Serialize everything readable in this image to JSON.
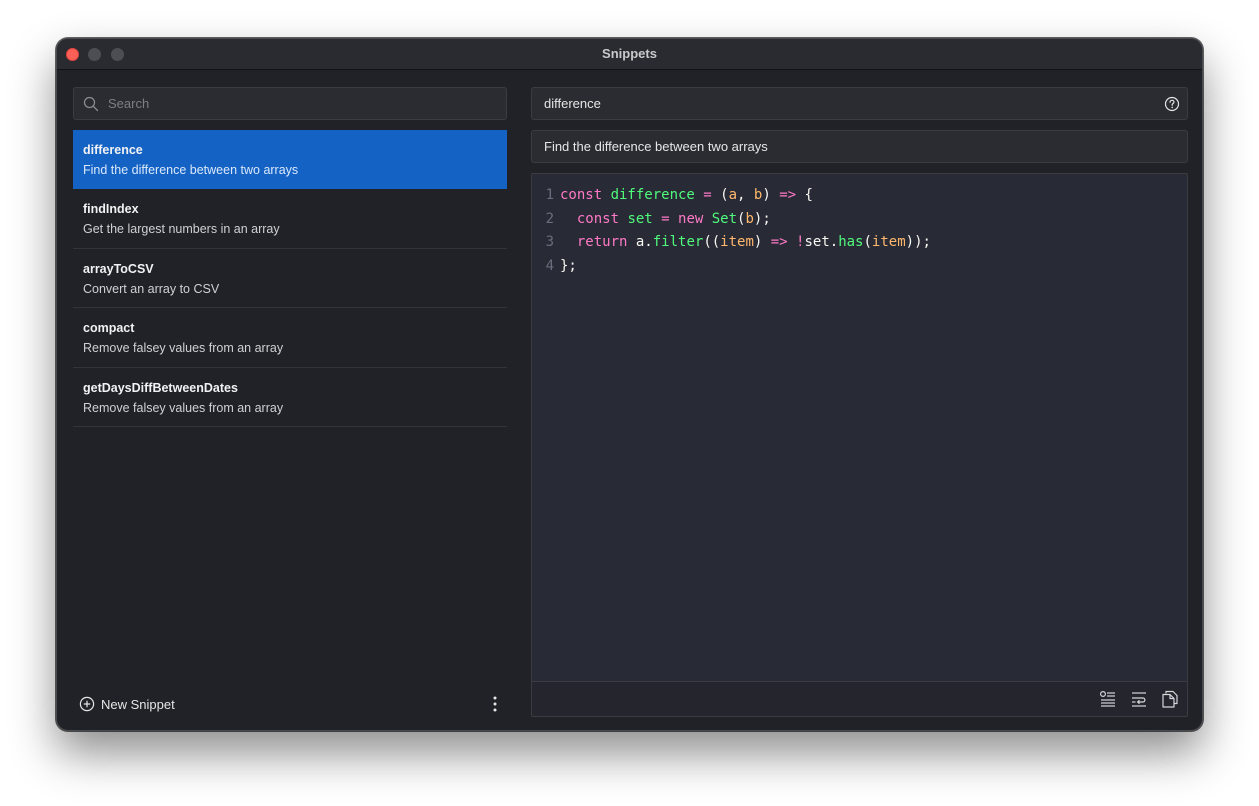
{
  "window": {
    "title": "Snippets"
  },
  "search": {
    "placeholder": "Search"
  },
  "snippets": [
    {
      "name": "difference",
      "description": "Find the difference between two arrays"
    },
    {
      "name": "findIndex",
      "description": "Get the largest numbers in an array"
    },
    {
      "name": "arrayToCSV",
      "description": "Convert an array to CSV"
    },
    {
      "name": "compact",
      "description": "Remove falsey values from an array"
    },
    {
      "name": "getDaysDiffBetweenDates",
      "description": "Remove falsey values from an array"
    }
  ],
  "sidebar_footer": {
    "new_snippet_label": "New Snippet"
  },
  "editor": {
    "name_value": "difference",
    "description_value": "Find the difference between two arrays",
    "line_numbers": [
      "1",
      "2",
      "3",
      "4"
    ]
  },
  "icons": {
    "search": "search-icon",
    "help": "help-icon",
    "new": "plus-circle-icon",
    "more": "more-vertical-icon",
    "format": "format-icon",
    "wrap": "wrap-text-icon",
    "copy": "copy-icon"
  },
  "colors": {
    "accent": "#1463c4",
    "close_button": "#fe5f57",
    "keyword": "#ff79c6",
    "function": "#50fa7b",
    "parameter": "#ffb86c",
    "class": "#8be9fd"
  }
}
